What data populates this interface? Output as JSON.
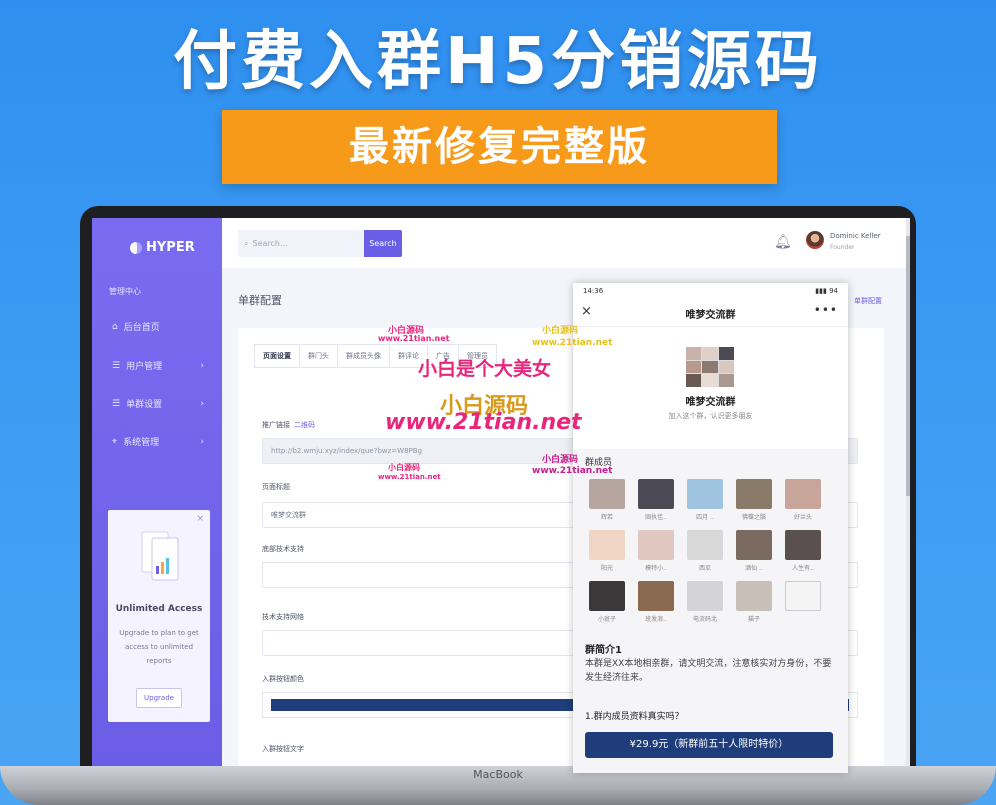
{
  "banner": {
    "title": "付费入群H5分销源码",
    "subtitle": "最新修复完整版"
  },
  "laptop": {
    "base_label": "MacBook"
  },
  "sidebar": {
    "logo": "HYPER",
    "heading": "管理中心",
    "items": [
      {
        "label": "后台首页",
        "icon": "home-icon"
      },
      {
        "label": "用户管理",
        "icon": "list-icon"
      },
      {
        "label": "单群设置",
        "icon": "list-icon"
      },
      {
        "label": "系统管理",
        "icon": "location-icon"
      }
    ],
    "promo": {
      "title": "Unlimited Access",
      "text": "Upgrade to plan to get access to unlimited reports",
      "button": "Upgrade",
      "close": "×"
    }
  },
  "topbar": {
    "search_placeholder": "Search...",
    "search_button": "Search",
    "user": {
      "name": "Dominic Keller",
      "role": "Founder"
    }
  },
  "page": {
    "title": "单群配置",
    "crumb": "单群配置"
  },
  "form": {
    "tabs": [
      "页面设置",
      "群门头",
      "群成员头像",
      "群评论",
      "广告",
      "管理员"
    ],
    "promo_link_label": "推广链接",
    "promo_link_link": "二维码",
    "promo_link_value": "http://b2.wmju.xyz/index/que?bwz=W8PBg",
    "page_title_label": "页面标题",
    "page_title_value": "唯梦交流群",
    "tech_support_label": "底部技术支持",
    "tech_support_link_label": "技术支持网络",
    "join_color_label": "入群按钮颜色",
    "join_text_label": "入群按钮文字"
  },
  "phone": {
    "status_time": "14:36",
    "status_right": "▮▮▮ 94",
    "nav_title": "唯梦交流群",
    "group_name": "唯梦交流群",
    "group_desc": "加入这个群，认识更多朋友",
    "members_title": "群成员",
    "members": [
      {
        "name": "辉若",
        "color": "#b7a6a0"
      },
      {
        "name": "固执佳..",
        "color": "#4b4a55"
      },
      {
        "name": "四月 ..",
        "color": "#9ec4e0"
      },
      {
        "name": "佛蝶之骸",
        "color": "#8a7a6a"
      },
      {
        "name": "好兰头",
        "color": "#c7a59a"
      },
      {
        "name": "阳光",
        "color": "#f0d4c4"
      },
      {
        "name": "模特小..",
        "color": "#e0c8c0"
      },
      {
        "name": "西瓜",
        "color": "#d8d8d8"
      },
      {
        "name": "酒仙 ..",
        "color": "#7a6a60"
      },
      {
        "name": "人生有..",
        "color": "#5a5050"
      },
      {
        "name": "小斑子",
        "color": "#3a3838"
      },
      {
        "name": "班发浪..",
        "color": "#8a6a50"
      },
      {
        "name": "电流码北",
        "color": "#d4d4d8"
      },
      {
        "name": "猫子",
        "color": "#c8c0b8"
      },
      {
        "name": "",
        "color": "#f4f4f4"
      }
    ],
    "intro_title": "群简介1",
    "intro_text": "本群是XX本地相亲群，请文明交流，注意核实对方身份，不要发生经济往来。",
    "faq": "1.群内成员资料真实吗？",
    "pay_button": "¥29.9元（新群前五十人限时特价）"
  },
  "watermarks": {
    "small_1": "小白源码",
    "small_1_url": "www.21tian.net",
    "small_2": "小白源码",
    "small_2_url": "www.21tian.net",
    "main": "小白是个大美女",
    "logo_text": "小白源码",
    "big_url": "www.21tian.net",
    "small_3": "小白源码",
    "small_3_url": "www.21tian.net",
    "small_4": "小白源码",
    "small_4_url": "www.21tian.net"
  }
}
